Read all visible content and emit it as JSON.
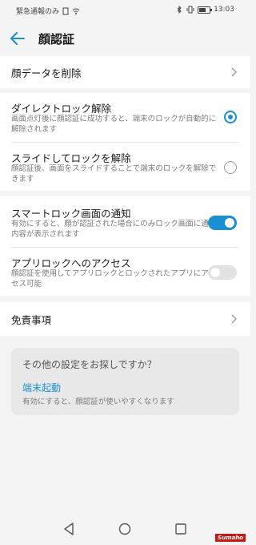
{
  "status_bar": {
    "left_text": "緊急通報のみ",
    "time": "13:03",
    "battery_level": 0.7
  },
  "app_bar": {
    "title": "顔認証",
    "back_icon": "arrow-left-icon"
  },
  "items": {
    "delete_face": {
      "title": "顔データを削除"
    },
    "direct_unlock": {
      "title": "ダイレクトロック解除",
      "desc": "画面点灯後に顔認証に成功すると、端末のロックが自動的に解除されます",
      "selected": true
    },
    "slide_unlock": {
      "title": "スライドしてロックを解除",
      "desc": "顔認証後、画面をスライドすることで端末のロックを解除できます",
      "selected": false
    },
    "smart_lock_notify": {
      "title": "スマートロック画面の通知",
      "desc": "有効にすると、顔が認証された場合にのみロック画面に通知内容が表示されます",
      "enabled": true
    },
    "app_lock_access": {
      "title": "アプリロックへのアクセス",
      "desc": "顔認証を使用してアプリロックとロックされたアプリにアクセス可能",
      "enabled": false
    },
    "disclaimer": {
      "title": "免責事項"
    }
  },
  "suggestion_card": {
    "title": "その他の設定をお探しですか？",
    "link": "端末起動",
    "desc": "有効にすると、顔認証が使いやすくなります"
  },
  "watermark": "Sumaho",
  "colors": {
    "accent": "#1a8fd4",
    "background": "#f4f4f4"
  }
}
